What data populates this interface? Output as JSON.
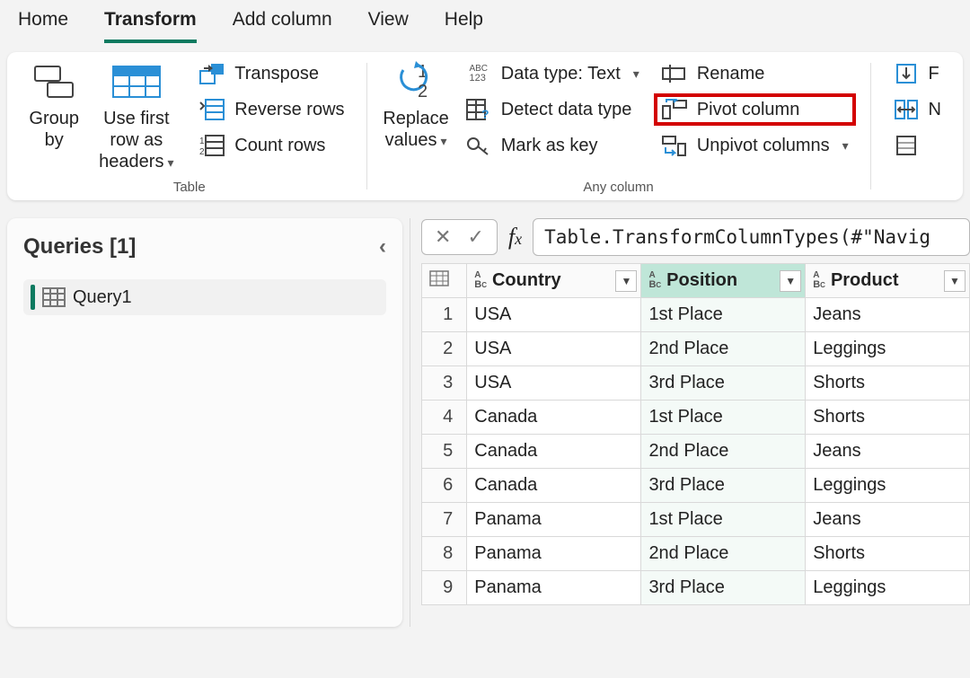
{
  "menu": {
    "items": [
      "Home",
      "Transform",
      "Add column",
      "View",
      "Help"
    ],
    "active": "Transform"
  },
  "ribbon": {
    "table": {
      "label": "Table",
      "group_by": "Group by",
      "use_first_row": "Use first row as headers",
      "transpose": "Transpose",
      "reverse_rows": "Reverse rows",
      "count_rows": "Count rows"
    },
    "anycol": {
      "label": "Any column",
      "replace_values": "Replace values",
      "data_type_label": "Data type: Text",
      "detect": "Detect data type",
      "mark_key": "Mark as key",
      "rename": "Rename",
      "pivot": "Pivot column",
      "unpivot": "Unpivot columns"
    },
    "extra": {
      "f": "F",
      "n": "N"
    }
  },
  "queries": {
    "title": "Queries [1]",
    "items": [
      "Query1"
    ]
  },
  "formula": {
    "text": "Table.TransformColumnTypes(#\"Navig"
  },
  "table": {
    "columns": [
      "Country",
      "Position",
      "Product"
    ],
    "selected_col": 1,
    "rows": [
      [
        "USA",
        "1st Place",
        "Jeans"
      ],
      [
        "USA",
        "2nd Place",
        "Leggings"
      ],
      [
        "USA",
        "3rd Place",
        "Shorts"
      ],
      [
        "Canada",
        "1st Place",
        "Shorts"
      ],
      [
        "Canada",
        "2nd Place",
        "Jeans"
      ],
      [
        "Canada",
        "3rd Place",
        "Leggings"
      ],
      [
        "Panama",
        "1st Place",
        "Jeans"
      ],
      [
        "Panama",
        "2nd Place",
        "Shorts"
      ],
      [
        "Panama",
        "3rd Place",
        "Leggings"
      ]
    ]
  }
}
